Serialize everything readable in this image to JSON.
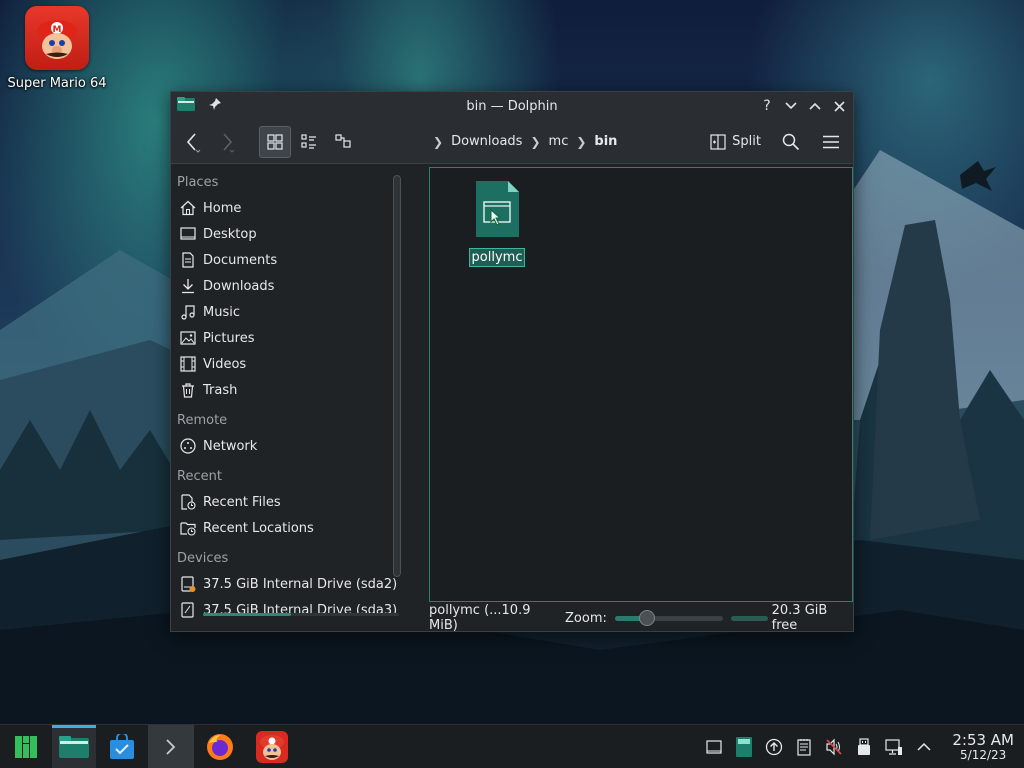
{
  "desktop": {
    "icon_label": "Super Mario 64"
  },
  "window": {
    "title": "bin — Dolphin",
    "titlebar_buttons": [
      "help-icon",
      "minimize-icon",
      "maximize-icon",
      "close-icon"
    ],
    "toolbar": {
      "breadcrumb": [
        "Downloads",
        "mc",
        "bin"
      ],
      "split_label": "Split"
    },
    "sidebar": {
      "sections": [
        {
          "title": "Places",
          "items": [
            {
              "label": "Home",
              "icon": "home-icon"
            },
            {
              "label": "Desktop",
              "icon": "desktop-icon"
            },
            {
              "label": "Documents",
              "icon": "documents-icon"
            },
            {
              "label": "Downloads",
              "icon": "downloads-icon"
            },
            {
              "label": "Music",
              "icon": "music-icon"
            },
            {
              "label": "Pictures",
              "icon": "pictures-icon"
            },
            {
              "label": "Videos",
              "icon": "videos-icon"
            },
            {
              "label": "Trash",
              "icon": "trash-icon"
            }
          ]
        },
        {
          "title": "Remote",
          "items": [
            {
              "label": "Network",
              "icon": "network-icon"
            }
          ]
        },
        {
          "title": "Recent",
          "items": [
            {
              "label": "Recent Files",
              "icon": "recent-files-icon"
            },
            {
              "label": "Recent Locations",
              "icon": "recent-locations-icon"
            }
          ]
        },
        {
          "title": "Devices",
          "items": [
            {
              "label": "37.5 GiB Internal Drive (sda2)",
              "icon": "drive-icon"
            },
            {
              "label": "37.5 GiB Internal Drive (sda3)",
              "icon": "drive-icon"
            }
          ]
        }
      ],
      "sda3_usage_fraction": 0.45
    },
    "files": [
      {
        "name": "pollymc",
        "icon": "executable-file-icon",
        "selected": true
      }
    ],
    "statusbar": {
      "selection_info": "pollymc (...10.9 MiB)",
      "zoom_label": "Zoom:",
      "zoom_fraction": 0.3,
      "free_space": "20.3 GiB free"
    }
  },
  "taskbar": {
    "apps": [
      {
        "name": "application-launcher",
        "icon": "manjaro-icon"
      },
      {
        "name": "dolphin",
        "icon": "folder-icon",
        "active": true
      },
      {
        "name": "discover",
        "icon": "store-icon"
      },
      {
        "name": "konsole",
        "icon": "terminal-icon"
      },
      {
        "name": "firefox",
        "icon": "firefox-icon"
      },
      {
        "name": "super-mario-64",
        "icon": "mario-icon"
      }
    ],
    "tray_icons": [
      "show-desktop-icon",
      "clipboard-icon",
      "updates-icon",
      "notes-icon",
      "volume-muted-icon",
      "usb-icon",
      "network-wired-icon",
      "expand-tray-icon"
    ],
    "clock": {
      "time": "2:53 AM",
      "date": "5/12/23"
    }
  },
  "colors": {
    "accent": "#3daee9",
    "selection_teal": "#1e5e55",
    "window_bg": "#202326"
  }
}
